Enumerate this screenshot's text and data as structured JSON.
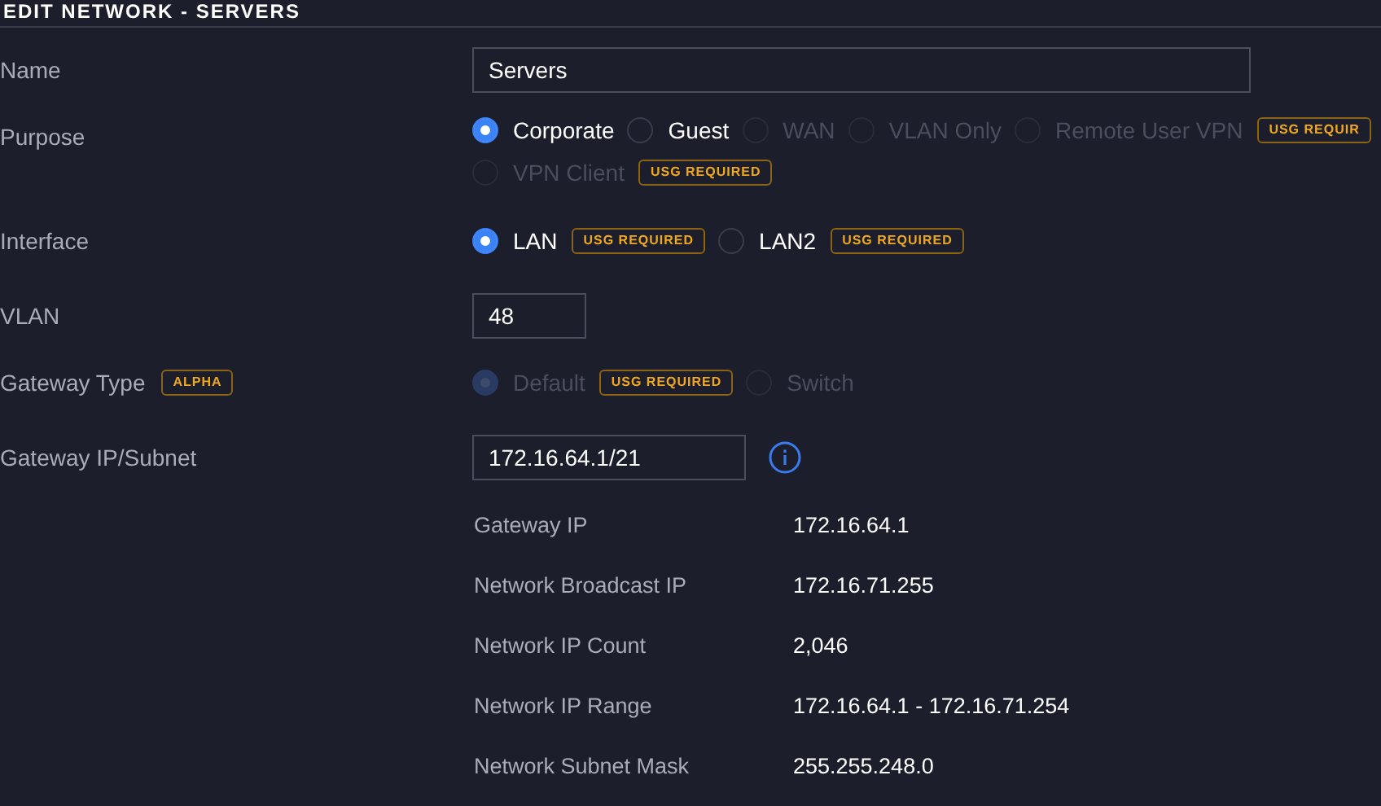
{
  "title": "EDIT NETWORK - SERVERS",
  "fields": [
    {
      "kind": "text",
      "label": "Name",
      "value": "Servers"
    },
    {
      "kind": "radio",
      "label": "Purpose",
      "options": [
        {
          "label": "Corporate",
          "selected": true,
          "disabled": false
        },
        {
          "label": "Guest",
          "selected": false,
          "disabled": false
        },
        {
          "label": "WAN",
          "selected": false,
          "disabled": true
        },
        {
          "label": "VLAN Only",
          "selected": false,
          "disabled": true
        },
        {
          "label": "Remote User VPN",
          "selected": false,
          "disabled": true,
          "badge": "USG REQUIR"
        },
        {
          "label": "VPN Client",
          "selected": false,
          "disabled": true,
          "badge": "USG REQUIRED"
        }
      ]
    },
    {
      "kind": "radio",
      "label": "Interface",
      "options": [
        {
          "label": "LAN",
          "selected": true,
          "disabled": false,
          "badge": "USG REQUIRED"
        },
        {
          "label": "LAN2",
          "selected": false,
          "disabled": false,
          "badge": "USG REQUIRED"
        }
      ]
    },
    {
      "kind": "text",
      "label": "VLAN",
      "value": "48"
    },
    {
      "kind": "radio",
      "label": "Gateway Type",
      "label_badge": "ALPHA",
      "options": [
        {
          "label": "Default",
          "selected": true,
          "disabled": true,
          "badge": "USG REQUIRED"
        },
        {
          "label": "Switch",
          "selected": false,
          "disabled": true
        }
      ]
    },
    {
      "kind": "text",
      "label": "Gateway IP/Subnet",
      "value": "172.16.64.1/21",
      "info": true
    }
  ],
  "details": [
    {
      "label": "Gateway IP",
      "value": "172.16.64.1"
    },
    {
      "label": "Network Broadcast IP",
      "value": "172.16.71.255"
    },
    {
      "label": "Network IP Count",
      "value": "2,046"
    },
    {
      "label": "Network IP Range",
      "value": "172.16.64.1 - 172.16.71.254"
    },
    {
      "label": "Network Subnet Mask",
      "value": "255.255.248.0"
    }
  ]
}
